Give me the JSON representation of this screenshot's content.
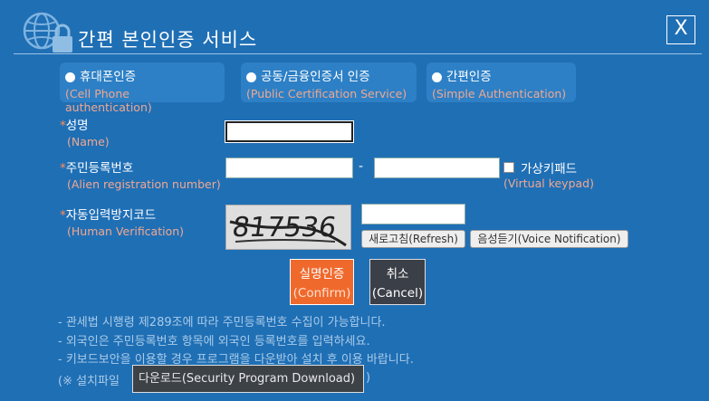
{
  "dialog": {
    "title": "간편 본인인증 서비스",
    "close_label": "X"
  },
  "methods": [
    {
      "label": "휴대폰인증",
      "sub": "(Cell Phone authentication)"
    },
    {
      "label": "공동/금융인증서 인증",
      "sub": "(Public Certification Service)"
    },
    {
      "label": "간편인증",
      "sub": "(Simple Authentication)"
    }
  ],
  "form": {
    "name": {
      "star": "*",
      "label": "성명",
      "sub": "(Name)",
      "value": ""
    },
    "registration": {
      "star": "*",
      "label": "주민등록번호",
      "sub": "(Alien registration number)",
      "dash": "-",
      "front_value": "",
      "back_value": ""
    },
    "virtual_keypad": {
      "label": "가상키패드",
      "sub": "(Virtual keypad)",
      "checked": false
    },
    "captcha": {
      "star": "*",
      "label": "자동입력방지코드",
      "sub": "(Human Verification)",
      "code": "817536",
      "value": ""
    },
    "refresh_label": "새로고침(Refresh)",
    "voice_label": "음성듣기(Voice Notification)"
  },
  "actions": {
    "confirm_label": "실명인증",
    "confirm_sub": "(Confirm)",
    "cancel_label": "취소",
    "cancel_sub": "(Cancel)"
  },
  "notes": [
    "- 관세법 시행령 제289조에 따라 주민등록번호 수집이 가능합니다.",
    "- 외국인은 주민등록번호 항목에 외국인 등록번호를 입력하세요.",
    "- 키보드보안을 이용할 경우 프로그램을 다운받아 설치 후 이용 바랍니다."
  ],
  "install": {
    "prefix": "(※ 설치파일",
    "download_label": "다운로드(Security Program Download)",
    "suffix": ")"
  },
  "colors": {
    "background": "#1f6fb5",
    "accent": "#f0692c",
    "sublabel": "#f0a890"
  }
}
